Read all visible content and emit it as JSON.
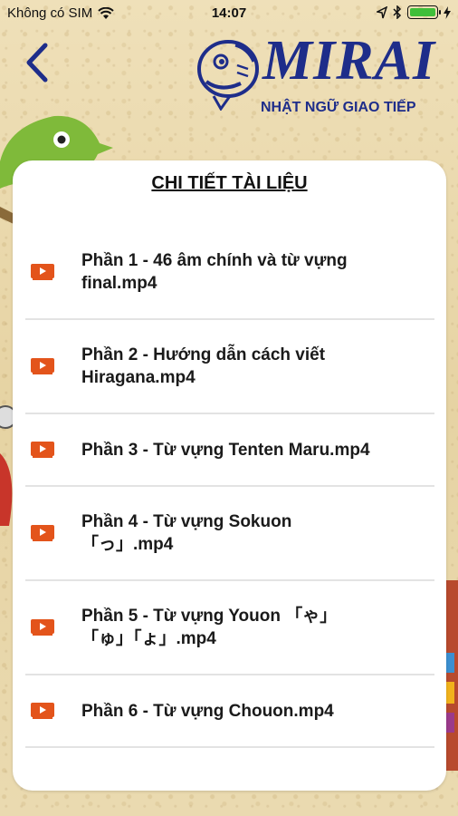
{
  "status_bar": {
    "carrier": "Không có SIM",
    "time": "14:07"
  },
  "logo": {
    "brand": "MIRAI",
    "subtitle": "NHẬT NGỮ GIAO TIẾP"
  },
  "card": {
    "title": "CHI TIẾT TÀI LIỆU",
    "items": [
      {
        "line1": "Phần 1 - 46 âm chính và từ vựng",
        "line2": "final.mp4"
      },
      {
        "line1": "Phần 2 - Hướng dẫn cách viết",
        "line2": "Hiragana.mp4"
      },
      {
        "line1": "Phần 3 - Từ vựng Tenten Maru.mp4",
        "line2": ""
      },
      {
        "line1": "Phần 4 - Từ vựng Sokuon",
        "line2": "「っ」.mp4"
      },
      {
        "line1": "Phần 5 - Từ vựng Youon 「ゃ」",
        "line2": "「ゅ」「ょ」.mp4"
      },
      {
        "line1": "Phần 6 - Từ vựng Chouon.mp4",
        "line2": ""
      }
    ]
  },
  "colors": {
    "brand_blue": "#1e2d8a",
    "video_icon": "#e3541b",
    "background": "#ead9ae"
  },
  "icons": [
    "wifi-icon",
    "location-icon",
    "bluetooth-icon",
    "battery-icon",
    "back-chevron-icon",
    "video-play-icon"
  ]
}
